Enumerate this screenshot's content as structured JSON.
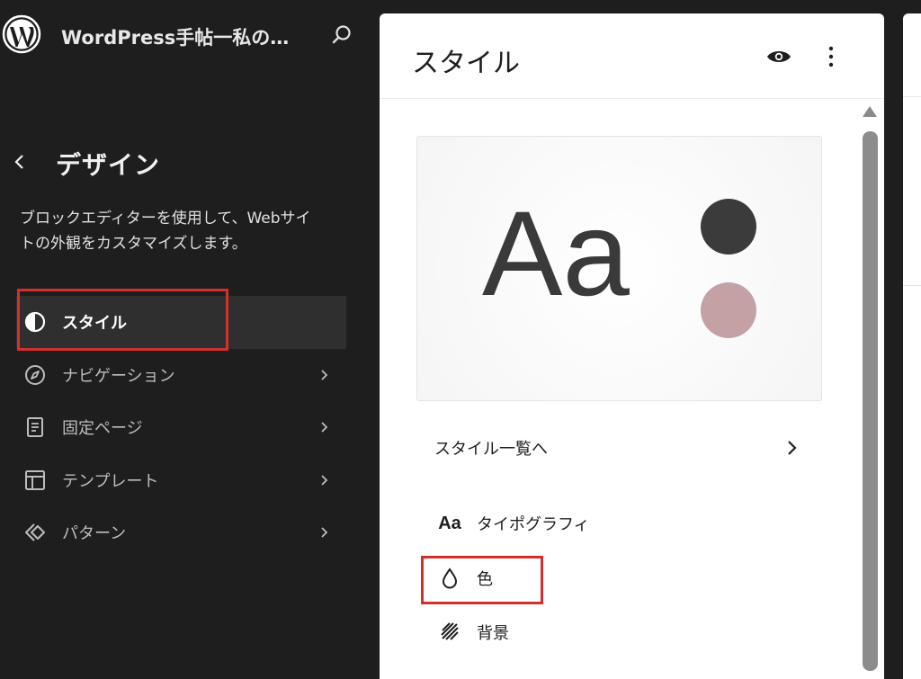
{
  "colors": {
    "sidebar_bg": "#1e1e1e",
    "active_item_bg": "#2f2f2f",
    "highlight": "#d32f2f",
    "swatch_primary": "#3b3b3b",
    "swatch_secondary": "#c4a1a5"
  },
  "sidebar": {
    "site_title": "WordPress手帖一私の…",
    "search_icon": "search-icon",
    "back_icon": "chevron-left-icon",
    "heading": "デザイン",
    "description": "ブロックエディターを使用して、Webサイトの外観をカスタマイズします。",
    "items": [
      {
        "label": "スタイル",
        "icon": "half-circle-icon",
        "active": true
      },
      {
        "label": "ナビゲーション",
        "icon": "compass-icon",
        "active": false
      },
      {
        "label": "固定ページ",
        "icon": "page-icon",
        "active": false
      },
      {
        "label": "テンプレート",
        "icon": "layout-icon",
        "active": false
      },
      {
        "label": "パターン",
        "icon": "pattern-icon",
        "active": false
      }
    ]
  },
  "panel": {
    "title": "スタイル",
    "preview_text": "Aa",
    "style_list_link": "スタイル一覧へ",
    "menu": [
      {
        "label": "タイポグラフィ",
        "icon": "typography-icon",
        "glyph": "Aa"
      },
      {
        "label": "色",
        "icon": "droplet-icon"
      },
      {
        "label": "背景",
        "icon": "background-icon"
      }
    ]
  }
}
